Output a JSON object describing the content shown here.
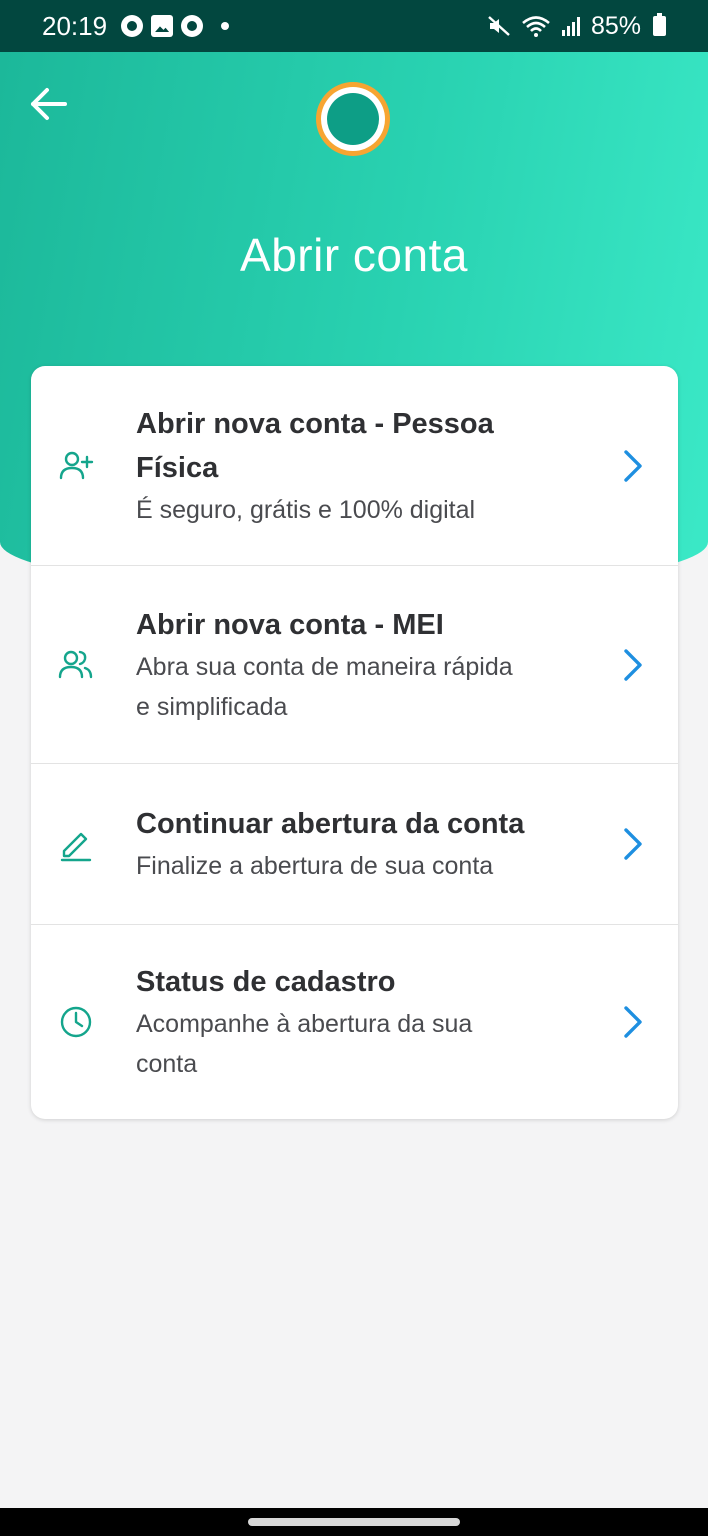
{
  "status_bar": {
    "time": "20:19",
    "battery": "85%",
    "left_icons": [
      "money-icon",
      "image-icon",
      "money-icon"
    ],
    "right_icons": [
      "mute-icon",
      "wifi-icon",
      "signal-icon",
      "battery-icon"
    ]
  },
  "header": {
    "title": "Abrir conta",
    "back_icon": "arrow-left-icon",
    "colors": {
      "gradient_start": "#1cb89a",
      "gradient_end": "#3be9c7",
      "logo_orange": "#f7a531",
      "logo_teal": "#0d9e86"
    }
  },
  "menu": {
    "items": [
      {
        "icon": "user-plus-icon",
        "title_line1": "Abrir nova conta - Pessoa",
        "title_line2": "Física",
        "subtitle_line1": "É seguro, grátis e 100% digital",
        "subtitle_line2": ""
      },
      {
        "icon": "users-icon",
        "title_line1": "Abrir nova conta - MEI",
        "title_line2": "",
        "subtitle_line1": "Abra sua conta de maneira rápida",
        "subtitle_line2": "e simplificada"
      },
      {
        "icon": "edit-icon",
        "title_line1": "Continuar abertura da conta",
        "title_line2": "",
        "subtitle_line1": "Finalize a abertura de sua conta",
        "subtitle_line2": ""
      },
      {
        "icon": "clock-icon",
        "title_line1": "Status de cadastro",
        "title_line2": "",
        "subtitle_line1": "Acompanhe à abertura da sua",
        "subtitle_line2": "conta"
      }
    ],
    "colors": {
      "icon": "#14a58c",
      "chevron": "#1e8fe0"
    }
  }
}
